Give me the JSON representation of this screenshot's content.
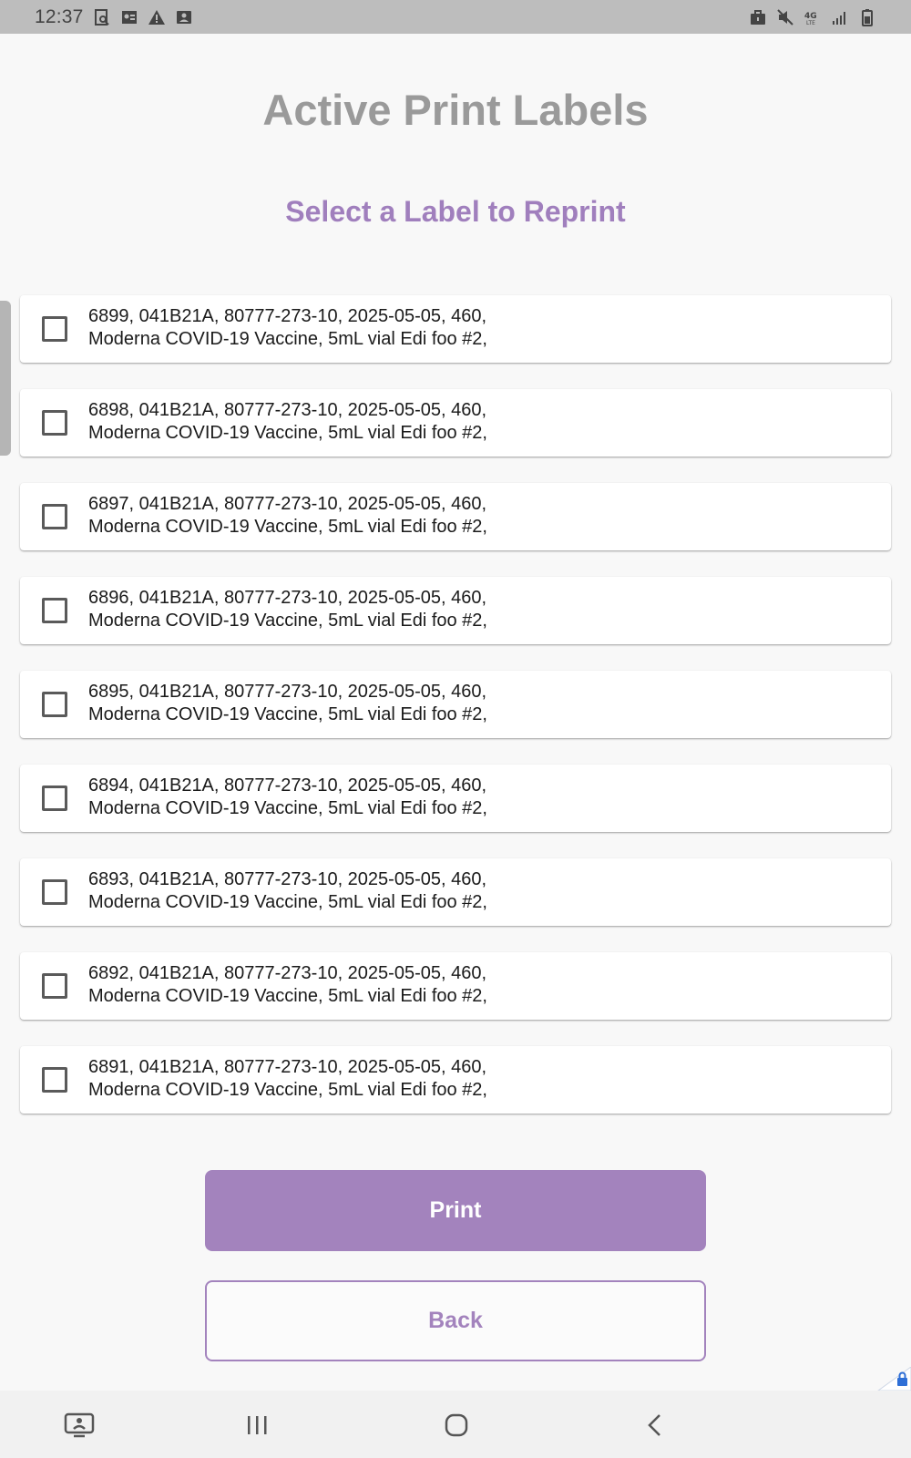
{
  "status_bar": {
    "time": "12:37",
    "left_icons": [
      "screenshot-icon",
      "contact-card-icon",
      "warning-icon",
      "account-box-icon"
    ],
    "right_icons": [
      "briefcase-icon",
      "mute-icon",
      "4g-lte-icon",
      "signal-icon",
      "battery-icon"
    ]
  },
  "page": {
    "title": "Active Print Labels",
    "subtitle": "Select a Label to Reprint"
  },
  "labels": [
    {
      "line1": "6899, 041B21A, 80777-273-10, 2025-05-05, 460,",
      "line2": "Moderna COVID-19 Vaccine, 5mL vial Edi foo #2,",
      "checked": false
    },
    {
      "line1": "6898, 041B21A, 80777-273-10, 2025-05-05, 460,",
      "line2": "Moderna COVID-19 Vaccine, 5mL vial Edi foo #2,",
      "checked": false
    },
    {
      "line1": "6897, 041B21A, 80777-273-10, 2025-05-05, 460,",
      "line2": "Moderna COVID-19 Vaccine, 5mL vial Edi foo #2,",
      "checked": false
    },
    {
      "line1": "6896, 041B21A, 80777-273-10, 2025-05-05, 460,",
      "line2": "Moderna COVID-19 Vaccine, 5mL vial Edi foo #2,",
      "checked": false
    },
    {
      "line1": "6895, 041B21A, 80777-273-10, 2025-05-05, 460,",
      "line2": "Moderna COVID-19 Vaccine, 5mL vial Edi foo #2,",
      "checked": false
    },
    {
      "line1": "6894, 041B21A, 80777-273-10, 2025-05-05, 460,",
      "line2": "Moderna COVID-19 Vaccine, 5mL vial Edi foo #2,",
      "checked": false
    },
    {
      "line1": "6893, 041B21A, 80777-273-10, 2025-05-05, 460,",
      "line2": "Moderna COVID-19 Vaccine, 5mL vial Edi foo #2,",
      "checked": false
    },
    {
      "line1": "6892, 041B21A, 80777-273-10, 2025-05-05, 460,",
      "line2": "Moderna COVID-19 Vaccine, 5mL vial Edi foo #2,",
      "checked": false
    },
    {
      "line1": "6891, 041B21A, 80777-273-10, 2025-05-05, 460,",
      "line2": "Moderna COVID-19 Vaccine, 5mL vial Edi foo #2,",
      "checked": false
    }
  ],
  "actions": {
    "print_label": "Print",
    "back_label": "Back"
  },
  "nav_bar": {
    "icons": [
      "screen-share-icon",
      "recent-apps-icon",
      "home-icon",
      "back-icon"
    ]
  },
  "colors": {
    "accent": "#a383bd",
    "subtitle": "#a07fbd",
    "title": "#9a9a9a",
    "status_bar": "#bdbdbd",
    "background": "#f8f8f8"
  }
}
